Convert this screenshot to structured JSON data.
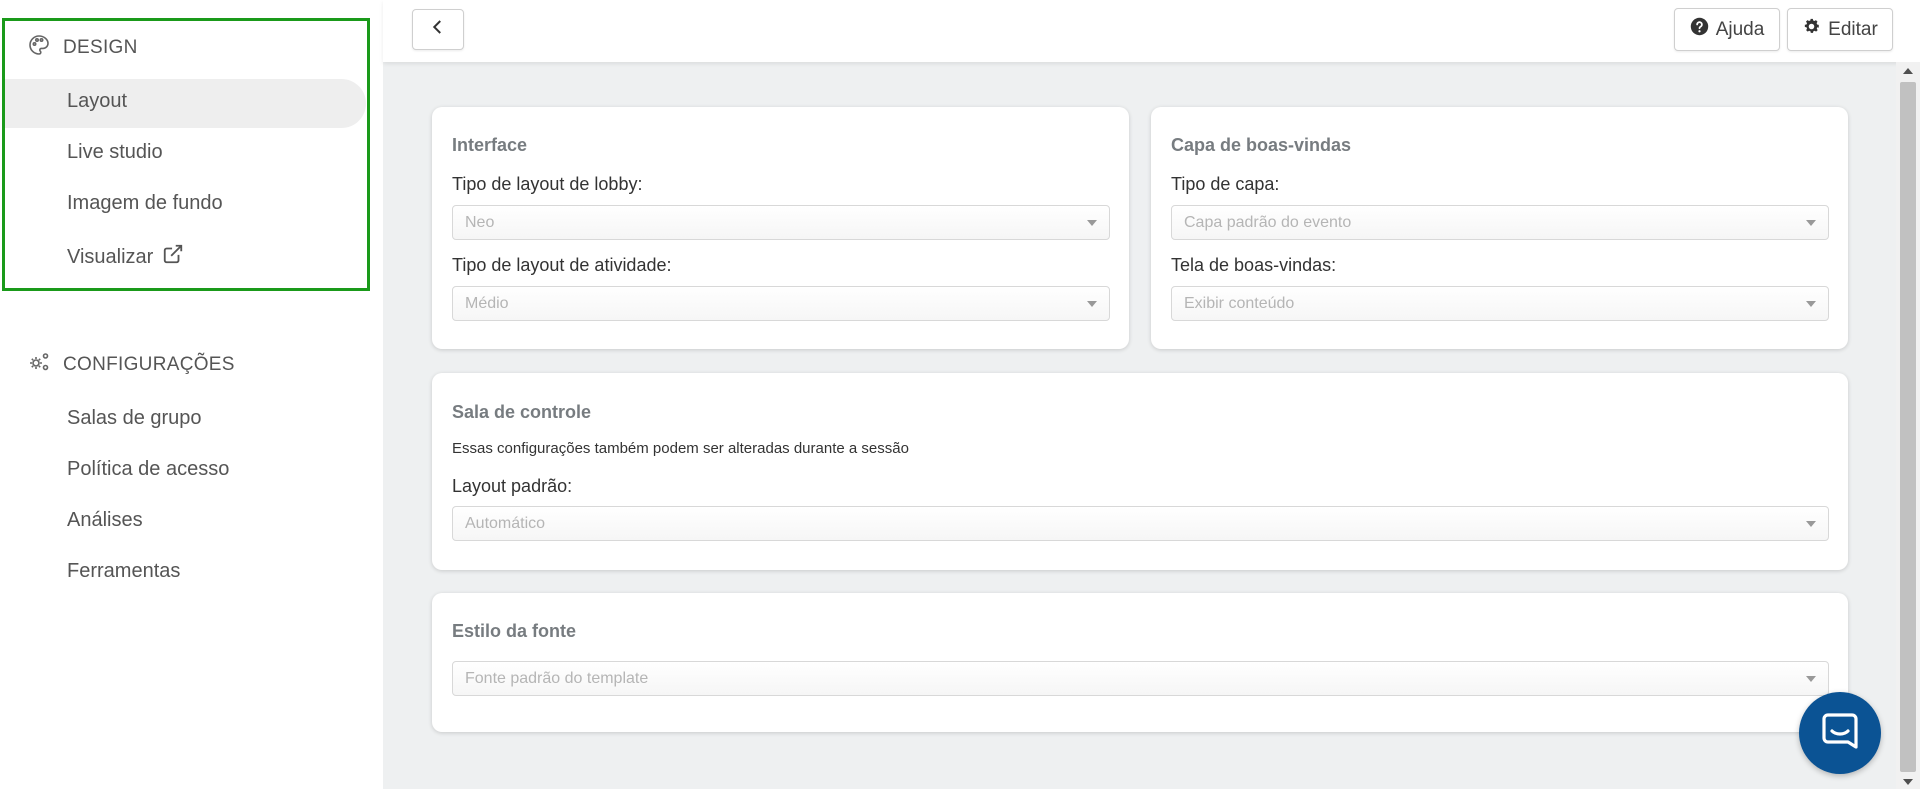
{
  "sidebar": {
    "design": {
      "title": "DESIGN",
      "items": [
        {
          "label": "Layout",
          "active": true
        },
        {
          "label": "Live studio"
        },
        {
          "label": "Imagem de fundo"
        },
        {
          "label": "Visualizar",
          "icon": "external-link-icon"
        }
      ]
    },
    "config": {
      "title": "CONFIGURAÇÕES",
      "items": [
        {
          "label": "Salas de grupo"
        },
        {
          "label": "Política de acesso"
        },
        {
          "label": "Análises"
        },
        {
          "label": "Ferramentas"
        }
      ]
    }
  },
  "topbar": {
    "back_icon": "chevron-left-icon",
    "help_label": "Ajuda",
    "edit_label": "Editar"
  },
  "cards": {
    "interface": {
      "title": "Interface",
      "lobby_label": "Tipo de layout de lobby:",
      "lobby_value": "Neo",
      "activity_label": "Tipo de layout de atividade:",
      "activity_value": "Médio"
    },
    "welcome": {
      "title": "Capa de boas-vindas",
      "cover_label": "Tipo de capa:",
      "cover_value": "Capa padrão do evento",
      "screen_label": "Tela de boas-vindas:",
      "screen_value": "Exibir conteúdo"
    },
    "control": {
      "title": "Sala de controle",
      "note": "Essas configurações também podem ser alteradas durante a sessão",
      "layout_label": "Layout padrão:",
      "layout_value": "Automático"
    },
    "font": {
      "title": "Estilo da fonte",
      "font_value": "Fonte padrão do template"
    }
  },
  "colors": {
    "highlight_border": "#1a9a1a",
    "chat_button": "#0b5394",
    "main_bg": "#eef0f1"
  }
}
